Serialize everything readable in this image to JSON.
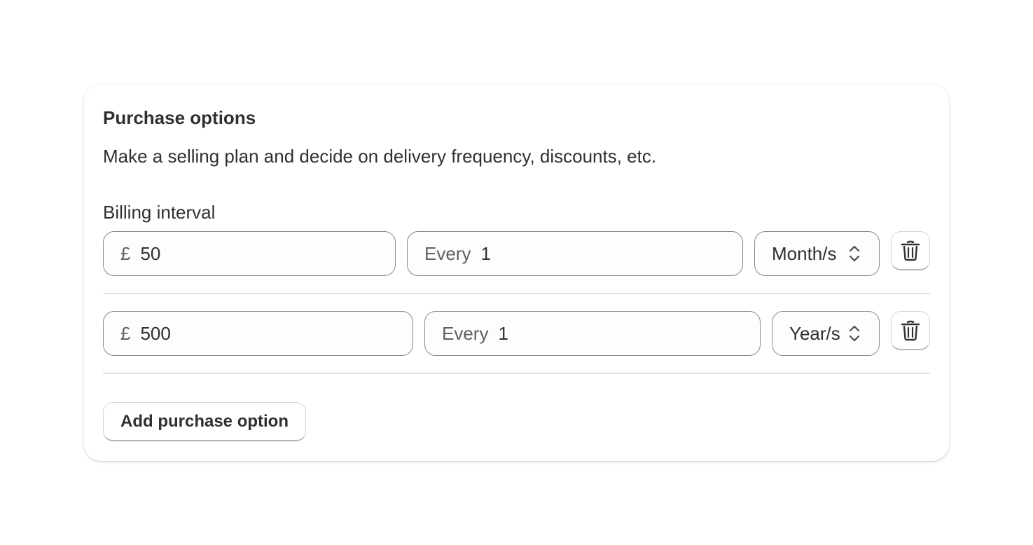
{
  "card": {
    "title": "Purchase options",
    "description": "Make a selling plan and decide on delivery frequency, discounts, etc.",
    "billing_label": "Billing interval"
  },
  "options": [
    {
      "currency_symbol": "£",
      "price": "50",
      "every_prefix": "Every",
      "every_value": "1",
      "interval": "Month/s"
    },
    {
      "currency_symbol": "£",
      "price": "500",
      "every_prefix": "Every",
      "every_value": "1",
      "interval": "Year/s"
    }
  ],
  "actions": {
    "add_label": "Add purchase option"
  },
  "icons": {
    "delete": "trash-icon",
    "select": "chevron-up-down-icon"
  }
}
